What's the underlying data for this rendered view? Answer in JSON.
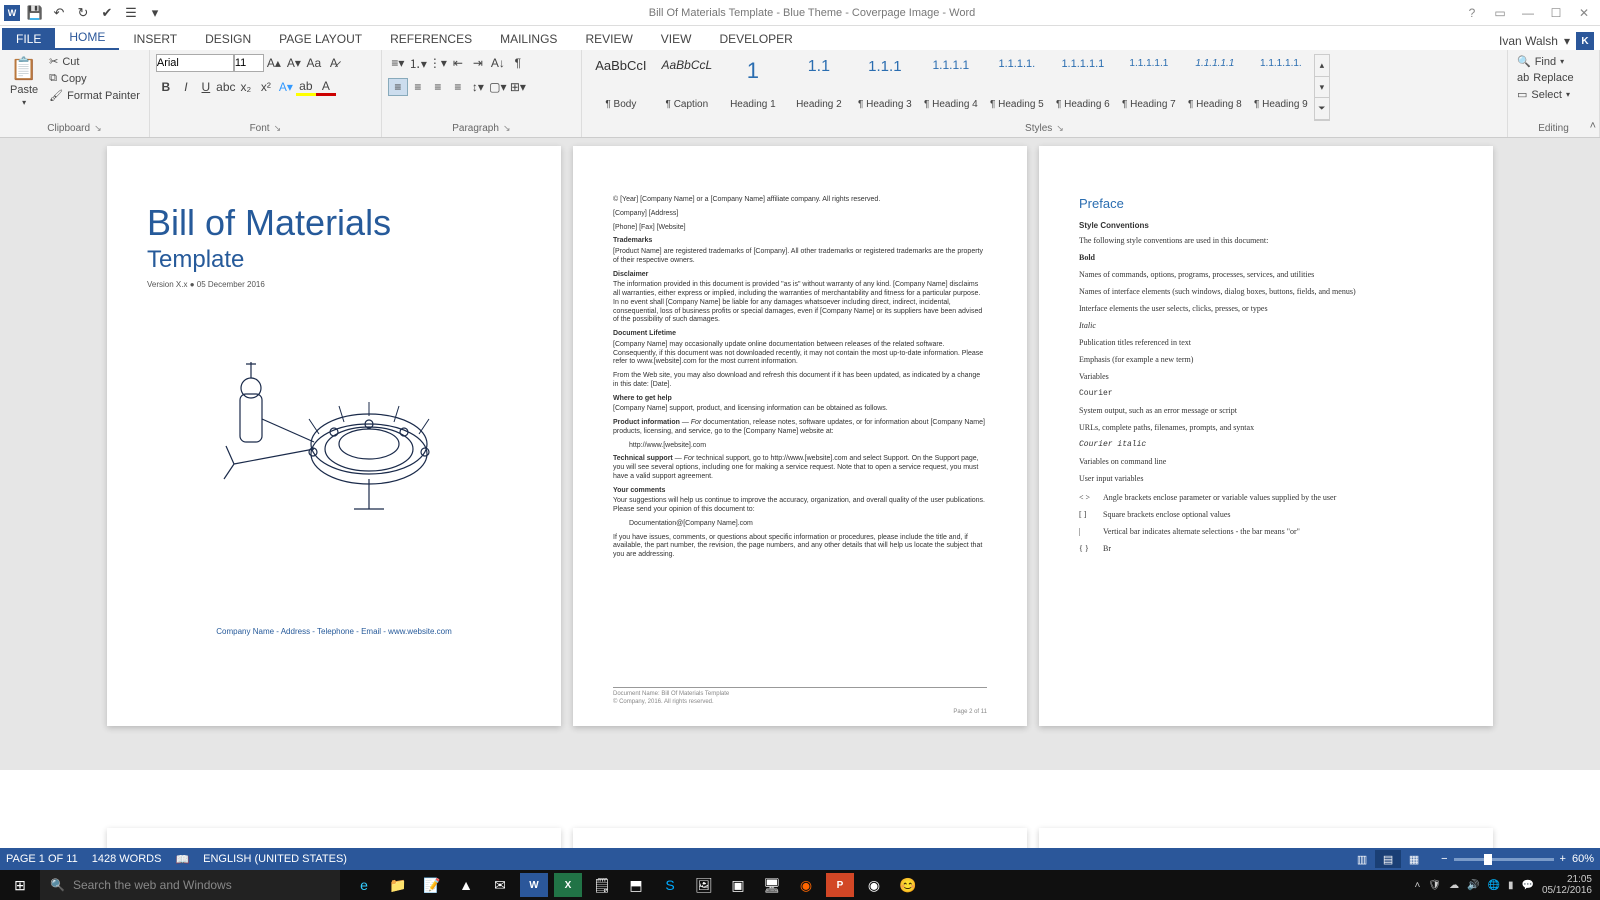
{
  "titlebar": {
    "title": "Bill Of Materials Template - Blue Theme - Coverpage Image - Word"
  },
  "account": {
    "name": "Ivan Walsh",
    "initial": "K"
  },
  "tabs": [
    "FILE",
    "HOME",
    "INSERT",
    "DESIGN",
    "PAGE LAYOUT",
    "REFERENCES",
    "MAILINGS",
    "REVIEW",
    "VIEW",
    "DEVELOPER"
  ],
  "ribbon": {
    "clipboard": {
      "paste": "Paste",
      "cut": "Cut",
      "copy": "Copy",
      "format_painter": "Format Painter",
      "label": "Clipboard"
    },
    "font": {
      "name": "Arial",
      "size": "11",
      "label": "Font"
    },
    "paragraph": {
      "label": "Paragraph"
    },
    "styles": {
      "label": "Styles",
      "items": [
        {
          "preview": "AaBbCcI",
          "name": "¶ Body"
        },
        {
          "preview": "AaBbCcL",
          "name": "¶ Caption"
        },
        {
          "preview": "1",
          "name": "Heading 1"
        },
        {
          "preview": "1.1",
          "name": "Heading 2"
        },
        {
          "preview": "1.1.1",
          "name": "¶ Heading 3"
        },
        {
          "preview": "1.1.1.1",
          "name": "¶ Heading 4"
        },
        {
          "preview": "1.1.1.1.",
          "name": "¶ Heading 5"
        },
        {
          "preview": "1.1.1.1.1",
          "name": "¶ Heading 6"
        },
        {
          "preview": "1.1.1.1.1",
          "name": "¶ Heading 7"
        },
        {
          "preview": "1.1.1.1.1",
          "name": "¶ Heading 8"
        },
        {
          "preview": "1.1.1.1.1.",
          "name": "¶ Heading 9"
        }
      ]
    },
    "editing": {
      "find": "Find",
      "replace": "Replace",
      "select": "Select",
      "label": "Editing"
    }
  },
  "cover": {
    "title": "Bill of Materials",
    "subtitle": "Template",
    "version": "Version X.x ● 05 December 2016",
    "footer": "Company Name - Address - Telephone - Email - www.website.com"
  },
  "legal": {
    "copyright": "© [Year] [Company Name] or a [Company Name] affiliate company. All rights reserved.",
    "company_line": "[Company] [Address]",
    "contact_line": "[Phone] [Fax] [Website]",
    "tm_title": "Trademarks",
    "tm_text": "[Product Name] are registered trademarks of [Company]. All other trademarks or registered trademarks are the property of their respective owners.",
    "disc_title": "Disclaimer",
    "disc_text": "The information provided in this document is provided \"as is\" without warranty of any kind. [Company Name] disclaims all warranties, either express or implied, including the warranties of merchantability and fitness for a particular purpose. In no event shall [Company Name] be liable for any damages whatsoever including direct, indirect, incidental, consequential, loss of business profits or special damages, even if [Company Name] or its suppliers have been advised of the possibility of such damages.",
    "life_title": "Document Lifetime",
    "life_text1": "[Company Name] may occasionally update online documentation between releases of the related software. Consequently, if this document was not downloaded recently, it may not contain the most up-to-date information. Please refer to www.[website].com for the most current information.",
    "life_text2": "From the Web site, you may also download and refresh this document if it has been updated, as indicated by a change in this date: [Date].",
    "help_title": "Where to get help",
    "help_text": "[Company Name] support, product, and licensing information can be obtained as follows.",
    "prodinfo_title": "Product information",
    "prodinfo_for": "For",
    "prodinfo_text": " documentation, release notes, software updates, or for information about [Company Name] products, licensing, and service, go to the [Company Name] website at:",
    "prodinfo_url": "http://www.[website].com",
    "tech_title": "Technical support",
    "tech_for": "For",
    "tech_text": " technical support, go to http://www.[website].com and select Support. On the Support page, you will see several options, including one for making a service request. Note that to open a service request, you must have a valid support agreement.",
    "comments_title": "Your comments",
    "comments_text1": "Your suggestions will help us continue to improve the accuracy, organization, and overall quality of the user publications. Please send your opinion of this document to:",
    "comments_email": "Documentation@[Company Name].com",
    "comments_text2": "If you have issues, comments, or questions about specific information or procedures, please include the title and, if available, the part number, the revision, the page numbers, and any other details that will help us locate the subject that you are addressing.",
    "foot_name": "Document Name: Bill Of Materials Template",
    "foot_copy": "© Company, 2016. All rights reserved.",
    "pagenum": "Page 2 of 11"
  },
  "preface": {
    "title": "Preface",
    "style_conventions": "Style Conventions",
    "intro": "The following style conventions are used in this document:",
    "rows": [
      {
        "t": "Bold",
        "c": "bold"
      },
      {
        "t": "Names of commands, options, programs, processes, services, and utilities"
      },
      {
        "t": "Names of interface elements (such windows, dialog boxes, buttons, fields, and menus)"
      },
      {
        "t": "Interface elements the user selects, clicks, presses, or types"
      },
      {
        "t": "Italic",
        "c": "italic"
      },
      {
        "t": "Publication titles referenced in text"
      },
      {
        "t": "Emphasis (for example a new term)"
      },
      {
        "t": "Variables"
      },
      {
        "t": "Courier",
        "c": "mono"
      },
      {
        "t": "System output, such as an error message or script"
      },
      {
        "t": "URLs, complete paths, filenames, prompts, and syntax"
      },
      {
        "t": "Courier italic",
        "c": "mono italic"
      },
      {
        "t": "Variables on command line"
      },
      {
        "t": "User input variables"
      }
    ],
    "symbols": [
      {
        "s": "< >",
        "d": "Angle brackets enclose parameter or variable values supplied by the user"
      },
      {
        "s": "[ ]",
        "d": "Square brackets enclose optional values"
      },
      {
        "s": "|",
        "d": "Vertical bar indicates alternate selections - the bar means \"or\""
      },
      {
        "s": "{ }",
        "d": "Br"
      }
    ]
  },
  "statusbar": {
    "page": "PAGE 1 OF 11",
    "words": "1428 WORDS",
    "lang": "ENGLISH (UNITED STATES)",
    "zoom": "60%"
  },
  "taskbar": {
    "search_placeholder": "Search the web and Windows",
    "time": "21:05",
    "date": "05/12/2016"
  }
}
